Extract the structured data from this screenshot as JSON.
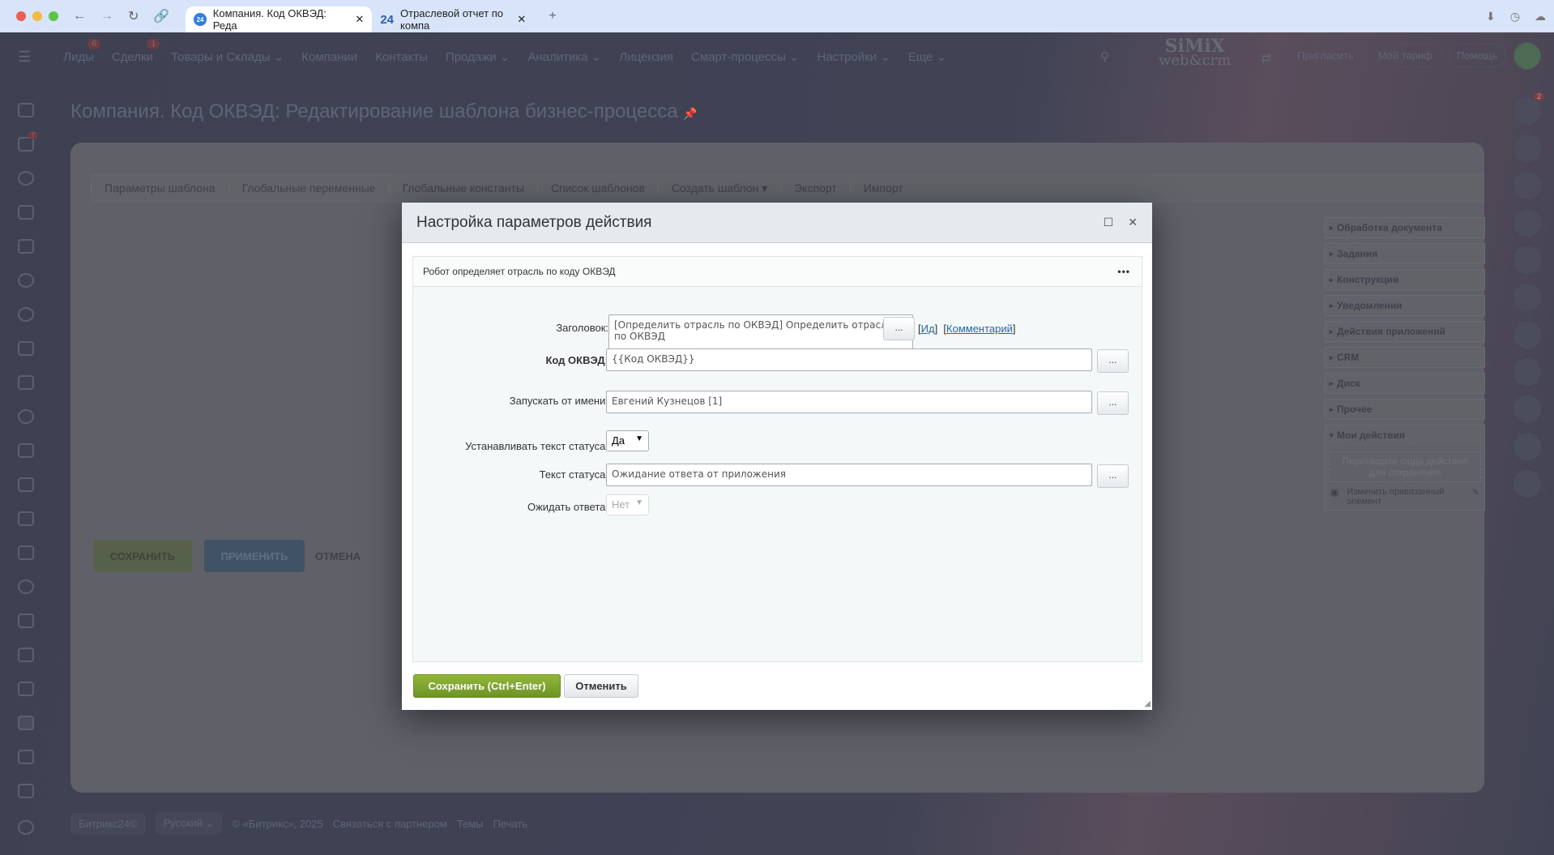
{
  "browser": {
    "tabs": [
      {
        "label": "Компания. Код ОКВЭД: Реда",
        "active": true
      },
      {
        "label": "Отраслевой отчет по компа",
        "active": false
      }
    ],
    "new_tab": "+"
  },
  "topnav": {
    "items": [
      {
        "label": "Лиды",
        "badge": "6"
      },
      {
        "label": "Сделки",
        "badge": "1"
      },
      {
        "label": "Товары и Склады ⌄"
      },
      {
        "label": "Компании"
      },
      {
        "label": "Контакты"
      },
      {
        "label": "Продажи ⌄"
      },
      {
        "label": "Аналитика ⌄"
      },
      {
        "label": "Лицензия"
      },
      {
        "label": "Смарт-процессы ⌄"
      },
      {
        "label": "Настройки ⌄"
      },
      {
        "label": "Еще ⌄"
      }
    ],
    "logo_top": "SiMiX",
    "logo_bottom": "web&crm",
    "buttons": [
      "Пригласить",
      "Мой тариф",
      "Помощь"
    ]
  },
  "sidebar": {
    "badge": "7",
    "notifications_badge": "2"
  },
  "page": {
    "title": "Компания. Код ОКВЭД: Редактирование шаблона бизнес-процесса",
    "tabs": [
      "Параметры шаблона",
      "Глобальные переменные",
      "Глобальные константы",
      "Список шаблонов",
      "Создать шаблон ▾",
      "Экспорт",
      "Импорт"
    ],
    "save": "СОХРАНИТЬ",
    "apply": "ПРИМЕНИТЬ",
    "cancel": "ОТМЕНА",
    "panel": {
      "groups": [
        "Обработка документа",
        "Задания",
        "Конструкции",
        "Уведомления",
        "Действия приложений",
        "CRM",
        "Диск",
        "Прочее",
        "Мои действия"
      ],
      "drop_hint": "Перетащите сюда действие для сохранения",
      "item": "Изменить привязанный элемент"
    }
  },
  "footer": {
    "brand": "Битрикс24©",
    "lang": "Русский ⌄",
    "copyright": "© «Битрикс», 2025",
    "links": [
      "Связаться с партнером",
      "Темы",
      "Печать"
    ]
  },
  "dialog": {
    "title": "Настройка параметров действия",
    "robot": "Робот определяет отрасль по коду ОКВЭД",
    "fields": {
      "title_label": "Заголовок:",
      "title_value": "[Определить отрасль по ОКВЭД] Определить отрасль по ОКВЭД",
      "id_link": "Ид",
      "comment_link": "Комментарий",
      "okved_label": "Код ОКВЭД:",
      "okved_value": "{{Код ОКВЭД}}",
      "run_as_label": "Запускать от имени:",
      "run_as_value": "Евгений Кузнецов [1]",
      "set_status_label": "Устанавливать текст статуса:",
      "set_status_value": "Да",
      "status_text_label": "Текст статуса:",
      "status_text_value": "Ожидание ответа от приложения",
      "wait_label": "Ожидать ответа:",
      "wait_value": "Нет"
    },
    "dots": "...",
    "save": "Сохранить (Ctrl+Enter)",
    "cancel": "Отменить"
  },
  "colors": {
    "accent_green": "#7fa52c",
    "link": "#2067b0"
  }
}
